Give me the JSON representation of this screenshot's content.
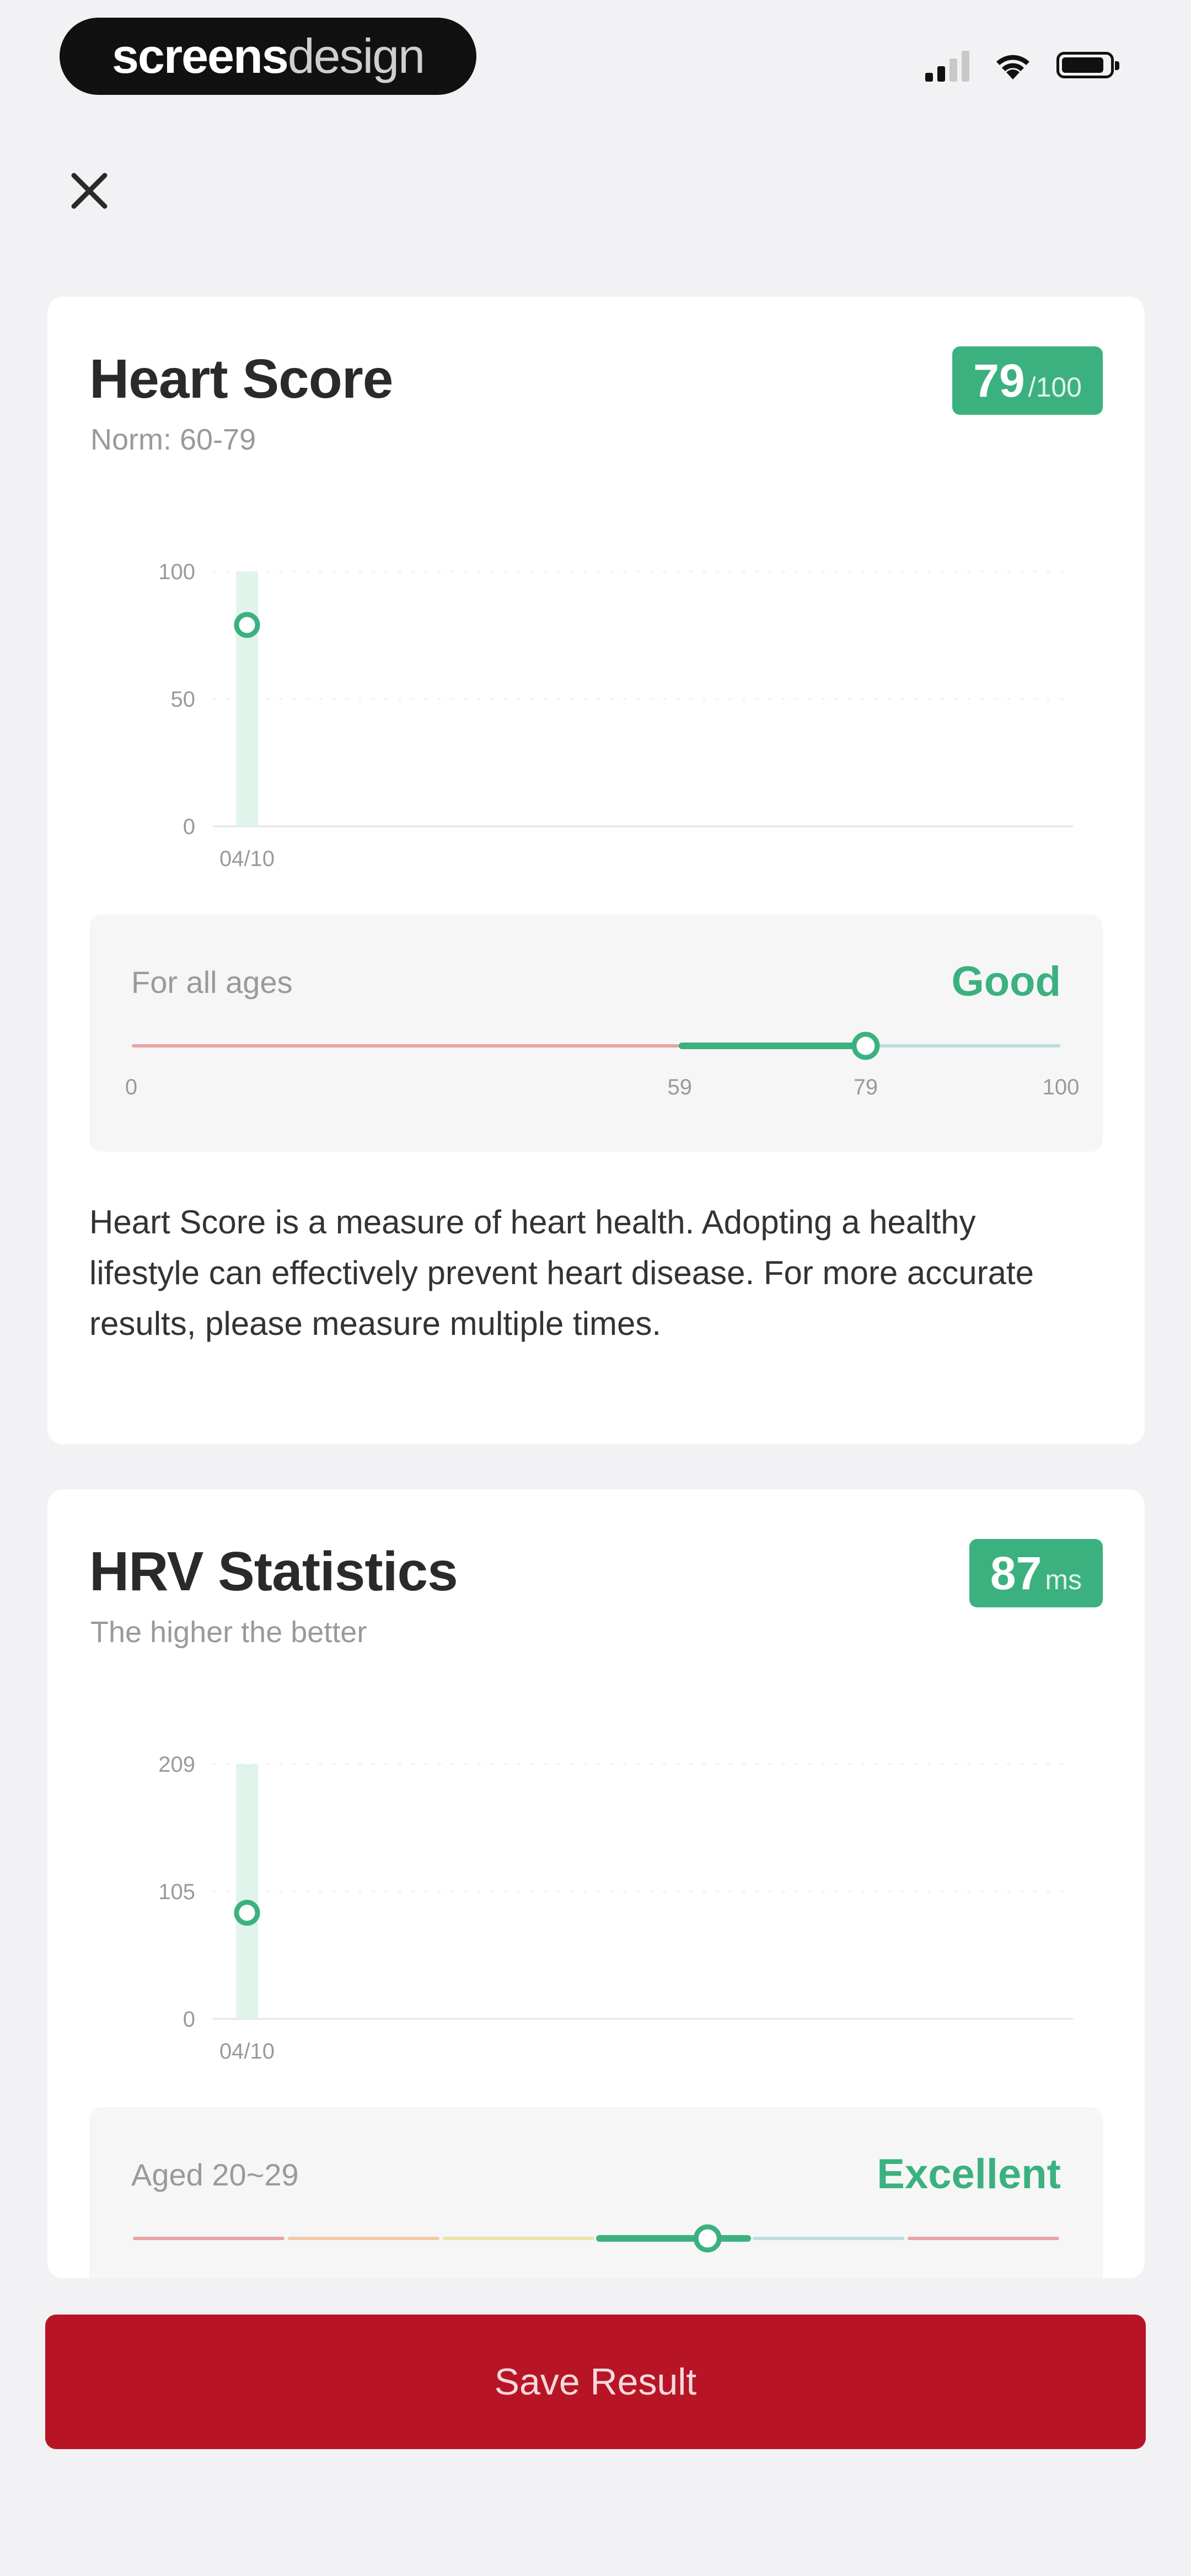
{
  "status_bar": {
    "brand_bold": "screens",
    "brand_light": "design"
  },
  "colors": {
    "accent": "#3bb17f",
    "save_button": "#b71526",
    "poor": "#e8a4a4",
    "fair": "#f2c9a8",
    "average": "#efe2a6",
    "good": "#3bb17f",
    "great": "#b9dedd"
  },
  "heart_score": {
    "title": "Heart Score",
    "subtitle": "Norm: 60-79",
    "badge_value": "79",
    "badge_unit": "/100",
    "range_label": "For all ages",
    "range_rating": "Good",
    "range_ticks": [
      "0",
      "59",
      "79",
      "100"
    ],
    "range_value": 79,
    "description": "Heart Score is a measure of heart health. Adopting a healthy lifestyle can effectively prevent heart disease. For more accurate results, please measure multiple times.",
    "chart_data": {
      "type": "scatter",
      "x": [
        "04/10"
      ],
      "y": [
        79
      ],
      "y_ticks": [
        "100",
        "50",
        "0"
      ],
      "ylim": [
        0,
        100
      ],
      "grid": true
    }
  },
  "hrv": {
    "title": "HRV Statistics",
    "subtitle": "The higher the better",
    "badge_value": "87",
    "badge_unit": "ms",
    "range_label": "Aged 20~29",
    "range_rating": "Excellent",
    "range_value_fraction": 0.62,
    "chart_data": {
      "type": "scatter",
      "x": [
        "04/10"
      ],
      "y": [
        87
      ],
      "y_ticks": [
        "209",
        "105",
        "0"
      ],
      "ylim": [
        0,
        209
      ],
      "grid": true
    }
  },
  "actions": {
    "save_label": "Save Result"
  }
}
